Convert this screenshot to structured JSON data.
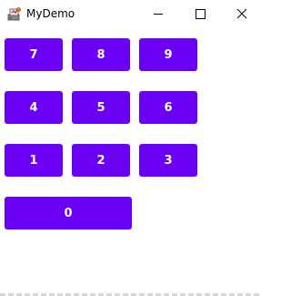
{
  "window": {
    "title": "MyDemo"
  },
  "titlebar_buttons": [
    "minimize-icon",
    "maximize-icon",
    "close-icon"
  ],
  "keypad": {
    "row1": [
      "7",
      "8",
      "9"
    ],
    "row2": [
      "4",
      "5",
      "6"
    ],
    "row3": [
      "1",
      "2",
      "3"
    ],
    "zero": "0"
  },
  "colors": {
    "key_background": "#6a00f4",
    "key_text": "#ffffff"
  }
}
